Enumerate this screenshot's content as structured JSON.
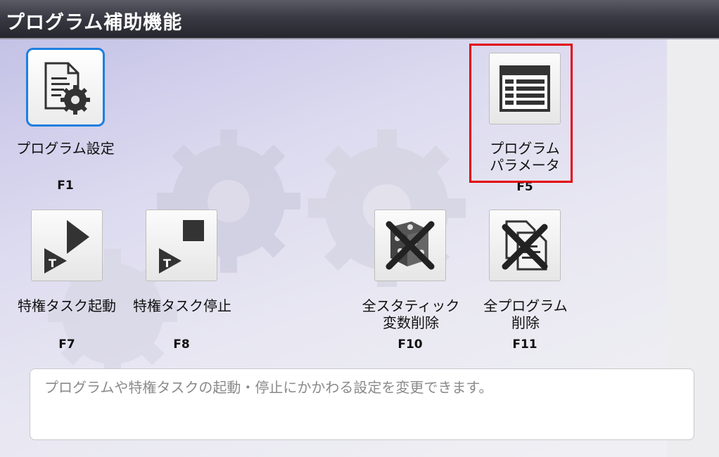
{
  "window": {
    "title": "プログラム補助機能"
  },
  "functions": [
    {
      "id": "program-settings",
      "label": "プログラム設定",
      "key": "F1",
      "icon": "document-gear-icon",
      "selected": true
    },
    {
      "id": "program-parameters",
      "label": "プログラム\nパラメータ",
      "key": "F5",
      "icon": "table-grid-icon",
      "highlighted": true
    },
    {
      "id": "privileged-task-start",
      "label": "特権タスク起動",
      "key": "F7",
      "icon": "task-play-icon"
    },
    {
      "id": "privileged-task-stop",
      "label": "特権タスク停止",
      "key": "F8",
      "icon": "task-stop-icon"
    },
    {
      "id": "delete-all-static-vars",
      "label": "全スタティック\n変数削除",
      "key": "F10",
      "icon": "delete-static-vars-icon"
    },
    {
      "id": "delete-all-programs",
      "label": "全プログラム\n削除",
      "key": "F11",
      "icon": "delete-programs-icon"
    }
  ],
  "description": "プログラムや特権タスクの起動・停止にかかわる設定を変更できます。",
  "colors": {
    "selection_border": "#1e7fe0",
    "highlight_box": "#e3000b"
  }
}
